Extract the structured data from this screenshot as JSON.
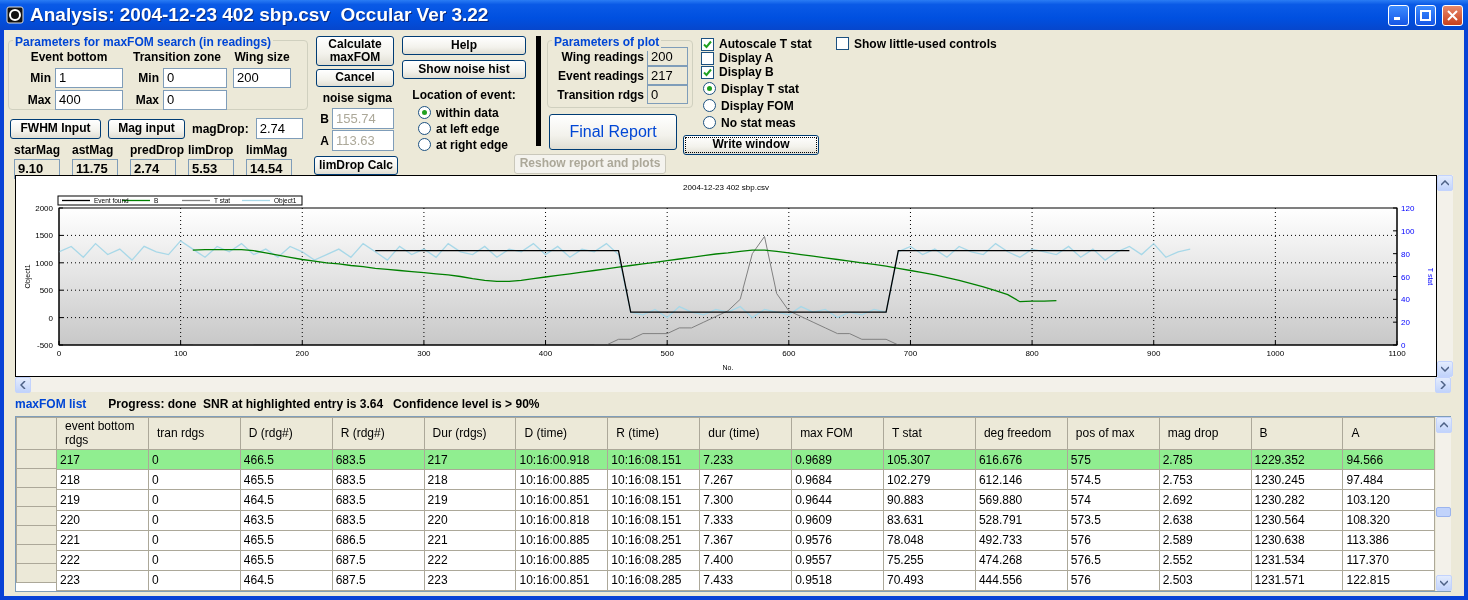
{
  "window": {
    "title": "Analysis: 2004-12-23 402 sbp.csv  Occular Ver 3.22"
  },
  "search_params": {
    "title": "Parameters for maxFOM search (in readings)",
    "groups": [
      {
        "label": "Event bottom",
        "fields": [
          {
            "label": "Min",
            "value": "1"
          },
          {
            "label": "Max",
            "value": "400"
          }
        ]
      },
      {
        "label": "Transition zone",
        "fields": [
          {
            "label": "Min",
            "value": "0"
          },
          {
            "label": "Max",
            "value": "0"
          }
        ]
      },
      {
        "label": "Wing size",
        "fields": [
          {
            "value": "200"
          }
        ]
      }
    ]
  },
  "input_buttons": [
    "FWHM Input",
    "Mag input"
  ],
  "mag_drop": {
    "label": "magDrop:",
    "value": "2.74"
  },
  "readouts": [
    {
      "label": "starMag",
      "value": "9.10"
    },
    {
      "label": "astMag",
      "value": "11.75"
    },
    {
      "label": "predDrop",
      "value": "2.74"
    },
    {
      "label": "limDrop",
      "value": "5.53"
    },
    {
      "label": "limMag",
      "value": "14.54"
    }
  ],
  "calc_buttons": [
    "Calculate maxFOM",
    "Cancel"
  ],
  "noise_sigma": {
    "label": "noise sigma",
    "fields": [
      {
        "label": "B",
        "value": "155.74",
        "disabled": true
      },
      {
        "label": "A",
        "value": "113.63",
        "disabled": true
      }
    ]
  },
  "limdrop_button": "limDrop Calc",
  "help_buttons": [
    "Help",
    "Show noise hist"
  ],
  "location": {
    "label": "Location of event:",
    "options": [
      {
        "label": "within data",
        "selected": true
      },
      {
        "label": "at left edge",
        "selected": false
      },
      {
        "label": "at right edge",
        "selected": false
      }
    ]
  },
  "plot_params": {
    "title": "Parameters of plot",
    "rows": [
      {
        "label": "Wing readings",
        "value": "200"
      },
      {
        "label": "Event readings",
        "value": "217"
      },
      {
        "label": "Transition rdgs",
        "value": "0"
      }
    ]
  },
  "final_report": "Final Report",
  "reshow_button": {
    "label": "Reshow report and plots",
    "disabled": true
  },
  "display_checks": [
    {
      "label": "Autoscale T stat",
      "checked": true
    },
    {
      "label": "Display A",
      "checked": false
    },
    {
      "label": "Display B",
      "checked": true
    }
  ],
  "stat_mode": [
    {
      "label": "Display T stat",
      "selected": true
    },
    {
      "label": "Display FOM",
      "selected": false
    },
    {
      "label": "No stat meas",
      "selected": false
    }
  ],
  "write_button": "Write window",
  "little_used": {
    "label": "Show little-used controls",
    "checked": false
  },
  "chart": {
    "chart_data": {
      "type": "line",
      "title": "2004-12-23 402 sbp.csv",
      "xlabel": "No.",
      "ylabel": "Object1",
      "y2label": "T stat",
      "xlim": [
        0,
        1100
      ],
      "ylim": [
        -500,
        2000
      ],
      "y2lim": [
        0,
        120
      ],
      "xticks": [
        0,
        100,
        200,
        300,
        400,
        500,
        600,
        700,
        800,
        900,
        1000,
        1100
      ],
      "yticks": [
        -500,
        0,
        500,
        1000,
        1500,
        2000
      ],
      "y2ticks": [
        0,
        20,
        40,
        60,
        80,
        100,
        120
      ],
      "grid": true,
      "legend": true,
      "x": [
        0,
        10,
        20,
        30,
        40,
        50,
        60,
        70,
        80,
        90,
        100,
        110,
        120,
        130,
        140,
        150,
        160,
        170,
        180,
        190,
        200,
        210,
        220,
        230,
        240,
        250,
        260,
        270,
        280,
        290,
        300,
        310,
        320,
        330,
        340,
        350,
        360,
        370,
        380,
        390,
        400,
        410,
        420,
        430,
        440,
        450,
        460,
        470,
        480,
        490,
        500,
        510,
        520,
        530,
        540,
        550,
        560,
        570,
        580,
        590,
        600,
        610,
        620,
        630,
        640,
        650,
        660,
        670,
        680,
        690,
        700,
        710,
        720,
        730,
        740,
        750,
        760,
        770,
        780,
        790,
        800,
        810,
        820,
        830,
        840,
        850,
        860,
        870,
        880,
        890,
        900,
        910,
        920,
        930
      ],
      "series": [
        {
          "name": "Event found",
          "color": "#000000",
          "values": [
            null,
            null,
            null,
            null,
            null,
            null,
            null,
            null,
            null,
            null,
            null,
            null,
            null,
            null,
            null,
            null,
            null,
            null,
            null,
            null,
            null,
            null,
            null,
            null,
            null,
            null,
            1220,
            1220,
            1220,
            1220,
            1220,
            1220,
            1220,
            1220,
            1220,
            1220,
            1220,
            1220,
            1220,
            1220,
            1220,
            1220,
            1220,
            1220,
            1220,
            1220,
            1220,
            100,
            100,
            100,
            100,
            100,
            100,
            100,
            100,
            100,
            100,
            100,
            100,
            100,
            100,
            100,
            100,
            100,
            100,
            100,
            100,
            100,
            100,
            1220,
            1220,
            1220,
            1220,
            1220,
            1220,
            1220,
            1220,
            1220,
            1220,
            1220,
            1220,
            1220,
            1220,
            1220,
            1220,
            1220,
            1220,
            1220,
            1220,
            null,
            null,
            null,
            null,
            null
          ]
        },
        {
          "name": "B",
          "color": "#008000",
          "values": [
            null,
            null,
            null,
            null,
            null,
            null,
            null,
            null,
            null,
            null,
            null,
            1230,
            1240,
            1240,
            1240,
            1240,
            1220,
            1180,
            1140,
            1100,
            1060,
            1030,
            1000,
            980,
            950,
            930,
            900,
            880,
            860,
            840,
            820,
            800,
            780,
            750,
            710,
            680,
            660,
            660,
            680,
            710,
            740,
            770,
            800,
            830,
            860,
            890,
            920,
            950,
            980,
            1010,
            1040,
            1070,
            1100,
            1130,
            1160,
            1180,
            1210,
            1230,
            1230,
            1210,
            1180,
            1150,
            1120,
            1090,
            1060,
            1030,
            1000,
            970,
            940,
            900,
            860,
            820,
            780,
            730,
            680,
            620,
            560,
            490,
            420,
            290,
            300,
            300,
            310,
            null,
            null,
            null,
            null,
            null,
            null,
            null,
            null,
            null,
            null,
            null
          ]
        },
        {
          "name": "T stat",
          "color": "#808080",
          "axis": "y2",
          "values": [
            null,
            null,
            null,
            null,
            null,
            null,
            null,
            null,
            null,
            null,
            null,
            0,
            0,
            0,
            0,
            0,
            0,
            null,
            null,
            null,
            null,
            null,
            null,
            null,
            null,
            null,
            null,
            null,
            null,
            null,
            null,
            null,
            null,
            null,
            null,
            null,
            null,
            null,
            null,
            null,
            null,
            null,
            null,
            null,
            0,
            0,
            5,
            5,
            10,
            10,
            10,
            15,
            15,
            20,
            25,
            30,
            40,
            80,
            95,
            45,
            30,
            25,
            20,
            15,
            10,
            10,
            5,
            5,
            5,
            0,
            0,
            null,
            null,
            null,
            null,
            null,
            null,
            null,
            null,
            null,
            null,
            null,
            null,
            null,
            null,
            null,
            null,
            null,
            null,
            null,
            null,
            null,
            null,
            null
          ]
        },
        {
          "name": "Object1",
          "color": "#a8d8e8",
          "values": [
            1200,
            1300,
            1100,
            1350,
            1150,
            1250,
            1050,
            1300,
            1200,
            1150,
            1400,
            1250,
            1100,
            1300,
            1200,
            1350,
            1150,
            1250,
            1100,
            1300,
            1200,
            1050,
            1150,
            1250,
            1100,
            1350,
            1200,
            1050,
            1300,
            1150,
            1250,
            1100,
            1350,
            1200,
            1150,
            1300,
            1100,
            1250,
            1200,
            1350,
            1150,
            1300,
            1100,
            1250,
            1200,
            1350,
            1150,
            100,
            50,
            150,
            0,
            200,
            100,
            50,
            150,
            100,
            200,
            0,
            150,
            100,
            50,
            200,
            100,
            150,
            0,
            100,
            50,
            150,
            100,
            1200,
            1300,
            1150,
            1250,
            1100,
            1300,
            1200,
            1150,
            1350,
            1200,
            1100,
            1250,
            1200,
            1150,
            1300,
            1100,
            1250,
            1050,
            1200,
            1300,
            1150,
            1350,
            1100,
            1200,
            1250
          ]
        }
      ]
    }
  },
  "list_title": "maxFOM list",
  "progress": "Progress: done  SNR at highlighted entry is 3.64   Confidence level is > 90%",
  "table": {
    "columns": [
      "event bottom rdgs",
      "tran rdgs",
      "D (rdg#)",
      "R (rdg#)",
      "Dur (rdgs)",
      "D (time)",
      "R (time)",
      "dur (time)",
      "max FOM",
      "T stat",
      "deg freedom",
      "pos of max",
      "mag drop",
      "B",
      "A"
    ],
    "rows": [
      {
        "selected": true,
        "cells": [
          "217",
          "0",
          "466.5",
          "683.5",
          "217",
          "10:16:00.918",
          "10:16:08.151",
          "7.233",
          "0.9689",
          "105.307",
          "616.676",
          "575",
          "2.785",
          "1229.352",
          "94.566"
        ]
      },
      {
        "selected": false,
        "cells": [
          "218",
          "0",
          "465.5",
          "683.5",
          "218",
          "10:16:00.885",
          "10:16:08.151",
          "7.267",
          "0.9684",
          "102.279",
          "612.146",
          "574.5",
          "2.753",
          "1230.245",
          "97.484"
        ]
      },
      {
        "selected": false,
        "cells": [
          "219",
          "0",
          "464.5",
          "683.5",
          "219",
          "10:16:00.851",
          "10:16:08.151",
          "7.300",
          "0.9644",
          "90.883",
          "569.880",
          "574",
          "2.692",
          "1230.282",
          "103.120"
        ]
      },
      {
        "selected": false,
        "cells": [
          "220",
          "0",
          "463.5",
          "683.5",
          "220",
          "10:16:00.818",
          "10:16:08.151",
          "7.333",
          "0.9609",
          "83.631",
          "528.791",
          "573.5",
          "2.638",
          "1230.564",
          "108.320"
        ]
      },
      {
        "selected": false,
        "cells": [
          "221",
          "0",
          "465.5",
          "686.5",
          "221",
          "10:16:00.885",
          "10:16:08.251",
          "7.367",
          "0.9576",
          "78.048",
          "492.733",
          "576",
          "2.589",
          "1230.638",
          "113.386"
        ]
      },
      {
        "selected": false,
        "cells": [
          "222",
          "0",
          "465.5",
          "687.5",
          "222",
          "10:16:00.885",
          "10:16:08.285",
          "7.400",
          "0.9557",
          "75.255",
          "474.268",
          "576.5",
          "2.552",
          "1231.534",
          "117.370"
        ]
      },
      {
        "selected": false,
        "cells": [
          "223",
          "0",
          "464.5",
          "687.5",
          "223",
          "10:16:00.851",
          "10:16:08.285",
          "7.433",
          "0.9518",
          "70.493",
          "444.556",
          "576",
          "2.503",
          "1231.571",
          "122.815"
        ]
      }
    ]
  }
}
